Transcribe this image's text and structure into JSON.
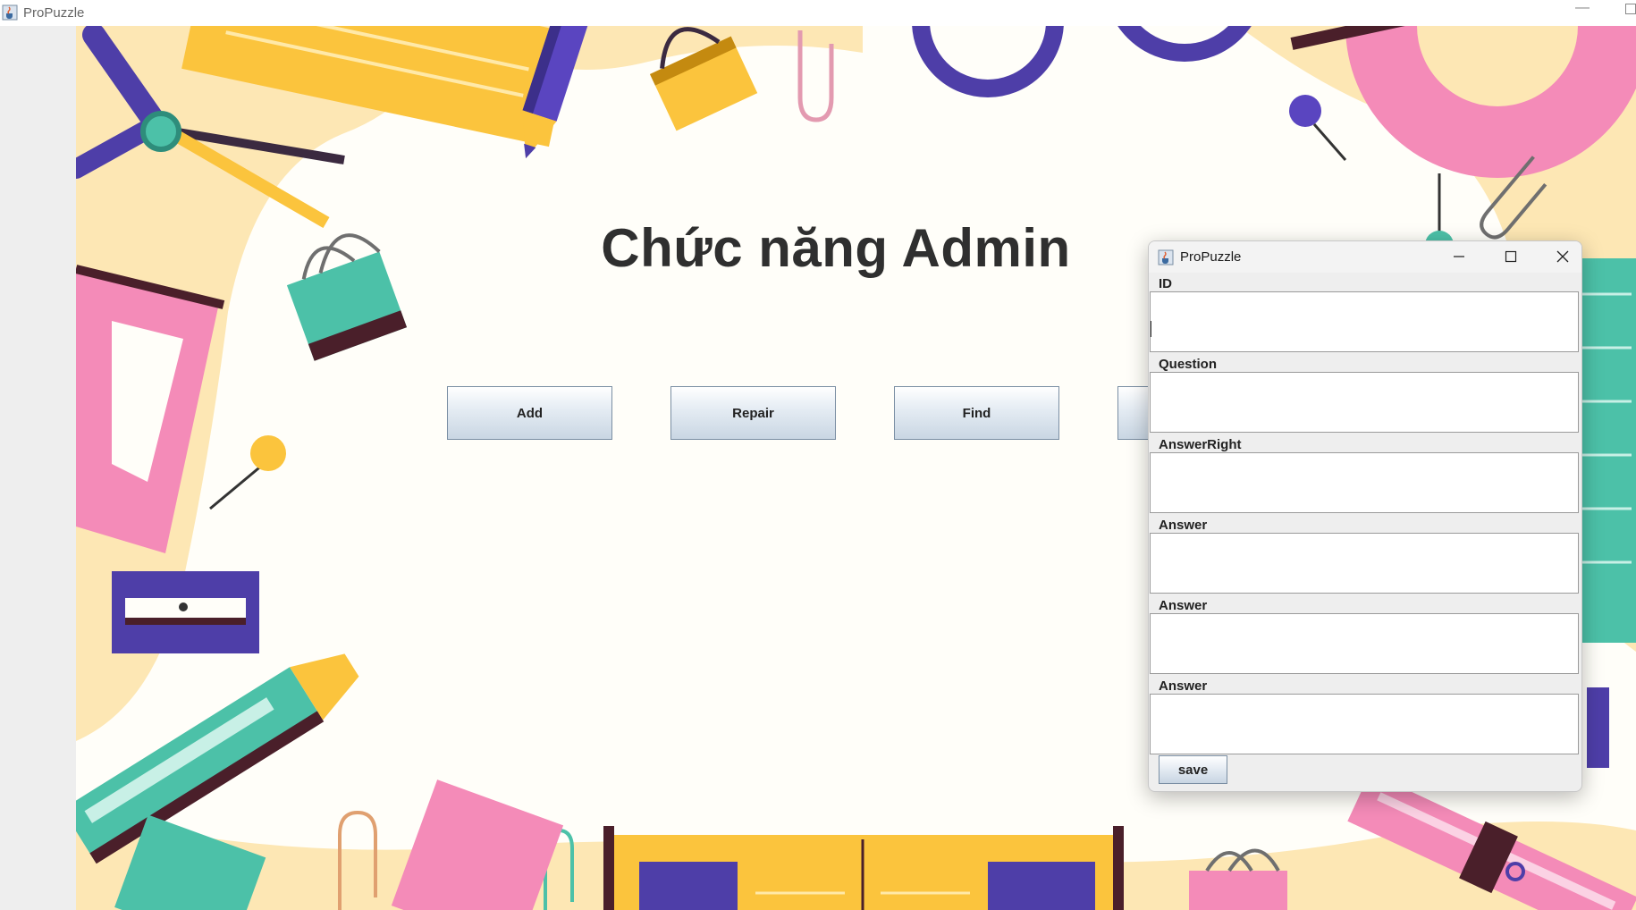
{
  "window": {
    "title": "ProPuzzle"
  },
  "main": {
    "heading": "Chức năng Admin",
    "buttons": {
      "add": "Add",
      "repair": "Repair",
      "find": "Find"
    }
  },
  "dialog": {
    "title": "ProPuzzle",
    "fields": [
      {
        "label": "ID",
        "value": ""
      },
      {
        "label": "Question",
        "value": ""
      },
      {
        "label": "AnswerRight",
        "value": ""
      },
      {
        "label": "Answer",
        "value": ""
      },
      {
        "label": "Answer",
        "value": ""
      },
      {
        "label": "Answer",
        "value": ""
      }
    ],
    "save_label": "save"
  },
  "colors": {
    "purple": "#4e3ea8",
    "yellow": "#fbc43d",
    "pink": "#f48bb8",
    "teal": "#4cc1a8",
    "cream": "#fde7b4",
    "dark": "#4a1f2a"
  },
  "icons": {
    "app": "java-cup-icon",
    "minimize": "minimize-icon",
    "maximize": "maximize-icon",
    "close": "close-icon"
  }
}
